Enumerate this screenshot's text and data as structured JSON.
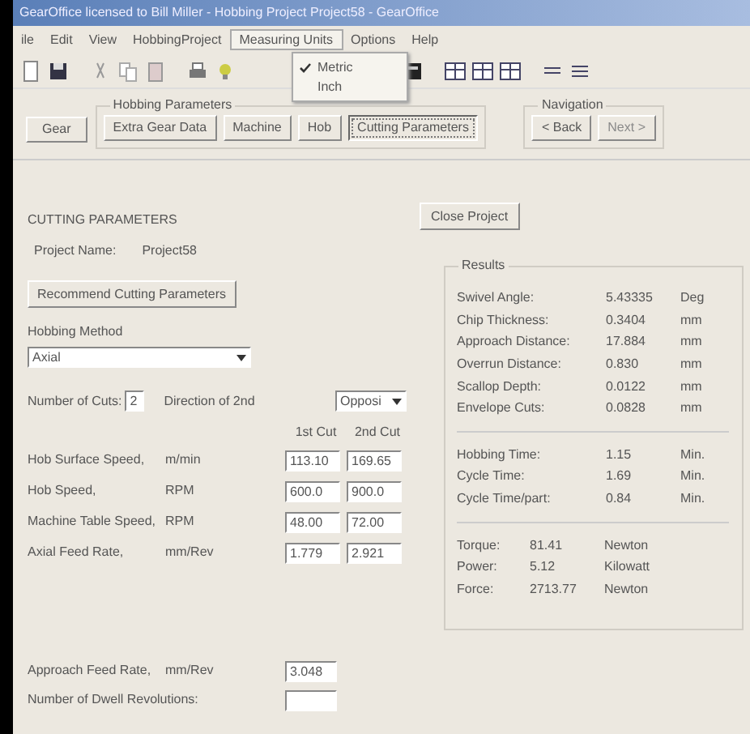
{
  "window": {
    "title": "GearOffice licensed to Bill Miller - Hobbing Project Project58 - GearOffice"
  },
  "menu": [
    {
      "label": "ile",
      "selected": false
    },
    {
      "label": "Edit",
      "selected": false
    },
    {
      "label": "View",
      "selected": false
    },
    {
      "label": "HobbingProject",
      "selected": false
    },
    {
      "label": "Measuring Units",
      "selected": true
    },
    {
      "label": "Options",
      "selected": false
    },
    {
      "label": "Help",
      "selected": false
    }
  ],
  "units_menu": [
    {
      "label": "Metric",
      "checked": true
    },
    {
      "label": "Inch",
      "checked": false
    }
  ],
  "gear_button": "Gear",
  "hobbing_parameters": {
    "title": "Hobbing Parameters",
    "tabs": [
      {
        "label": "Extra Gear Data",
        "selected": false
      },
      {
        "label": "Machine",
        "selected": false
      },
      {
        "label": "Hob",
        "selected": false
      },
      {
        "label": "Cutting Parameters",
        "selected": true
      }
    ]
  },
  "navigation": {
    "title": "Navigation",
    "buttons": [
      {
        "label": "< Back",
        "disabled": false
      },
      {
        "label": "Next >",
        "disabled": true
      }
    ]
  },
  "heading": "CUTTING PARAMETERS",
  "project_name": {
    "label": "Project Name:",
    "value": "Project58"
  },
  "recommend_button": "Recommend Cutting Parameters",
  "close_button": "Close Project",
  "hobbing_method": {
    "label": "Hobbing Method",
    "value": "Axial"
  },
  "cuts": {
    "label": "Number of Cuts:",
    "value": "2",
    "direction_label": "Direction of 2nd",
    "direction_value": "Opposi"
  },
  "cut_columns": [
    "1st Cut",
    "2nd Cut"
  ],
  "cut_rows": [
    {
      "label": "Hob Surface Speed,",
      "unit": "m/min",
      "values": [
        "113.10",
        "169.65"
      ]
    },
    {
      "label": "Hob Speed,",
      "unit": "RPM",
      "values": [
        "600.0",
        "900.0"
      ]
    },
    {
      "label": "Machine Table Speed,",
      "unit": "RPM",
      "values": [
        "48.00",
        "72.00"
      ]
    },
    {
      "label": "Axial Feed Rate,",
      "unit": "mm/Rev",
      "values": [
        "1.779",
        "2.921"
      ]
    }
  ],
  "approach": {
    "label": "Approach Feed Rate,",
    "unit": "mm/Rev",
    "value": "3.048"
  },
  "dwell": {
    "label": "Number of Dwell Revolutions:"
  },
  "results": {
    "title": "Results",
    "sections": [
      [
        {
          "label": "Swivel Angle:",
          "value": "5.43335",
          "unit": "Deg"
        },
        {
          "label": "Chip Thickness:",
          "value": "0.3404",
          "unit": "mm"
        },
        {
          "label": "Approach Distance:",
          "value": "17.884",
          "unit": "mm"
        },
        {
          "label": "Overrun Distance:",
          "value": "0.830",
          "unit": "mm"
        },
        {
          "label": "Scallop Depth:",
          "value": "0.0122",
          "unit": "mm"
        },
        {
          "label": "Envelope Cuts:",
          "value": "0.0828",
          "unit": "mm"
        }
      ],
      [
        {
          "label": "Hobbing Time:",
          "value": "1.15",
          "unit": "Min."
        },
        {
          "label": "Cycle Time:",
          "value": "1.69",
          "unit": "Min."
        },
        {
          "label": "Cycle Time/part:",
          "value": "0.84",
          "unit": "Min."
        }
      ],
      [
        {
          "label": "Torque:",
          "value": "81.41",
          "unit": "Newton"
        },
        {
          "label": "Power:",
          "value": "5.12",
          "unit": "Kilowatt"
        },
        {
          "label": "Force:",
          "value": "2713.77",
          "unit": "Newton"
        }
      ]
    ]
  }
}
